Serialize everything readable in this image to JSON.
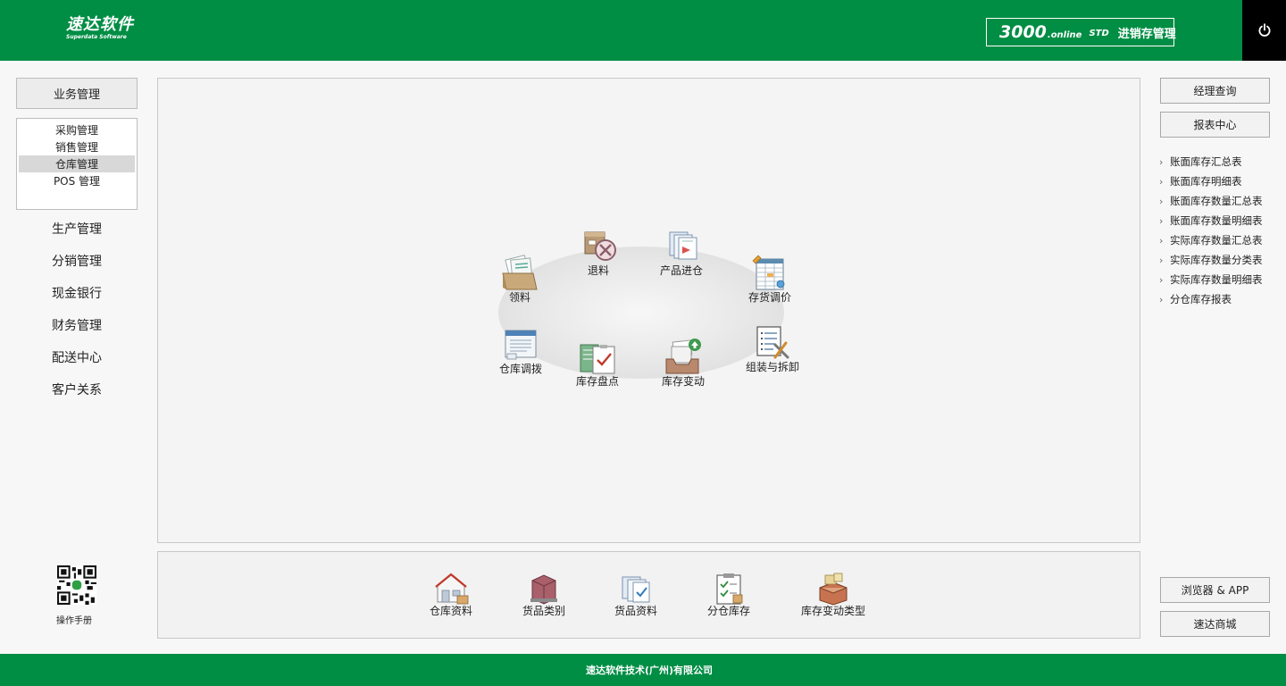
{
  "header": {
    "logo_cn": "速达软件",
    "logo_en": "Superdata Software",
    "product_num": "3000",
    "product_online": ".online",
    "product_std": "STD",
    "product_title": "进销存管理"
  },
  "left": {
    "section_head": "业务管理",
    "submenu": [
      {
        "label": "采购管理",
        "active": false
      },
      {
        "label": "销售管理",
        "active": false
      },
      {
        "label": "仓库管理",
        "active": true
      },
      {
        "label": "POS 管理",
        "active": false
      }
    ],
    "nav": [
      "生产管理",
      "分销管理",
      "现金银行",
      "财务管理",
      "配送中心",
      "客户关系"
    ],
    "qr_label": "操作手册"
  },
  "main": {
    "functions": {
      "lingliao": "领料",
      "tuiliao": "退料",
      "chanpin_jincang": "产品进仓",
      "cunhuo_tiaojia": "存货调价",
      "cangku_tiaobo": "仓库调拨",
      "kucun_pandian": "库存盘点",
      "kucun_biandong": "库存变动",
      "zuzhuang_chaixie": "组装与拆卸"
    },
    "bottom": [
      "仓库资料",
      "货品类别",
      "货品资料",
      "分仓库存",
      "库存变动类型"
    ]
  },
  "right": {
    "btn_manager_query": "经理查询",
    "btn_report_center": "报表中心",
    "reports": [
      "账面库存汇总表",
      "账面库存明细表",
      "账面库存数量汇总表",
      "账面库存数量明细表",
      "实际库存数量汇总表",
      "实际库存数量分类表",
      "实际库存数量明细表",
      "分仓库存报表"
    ],
    "btn_browser_app": "浏览器 & APP",
    "btn_mall": "速达商城"
  },
  "footer": {
    "company": "速达软件技术(广州)有限公司"
  },
  "colors": {
    "brand_green": "#008d44",
    "power_bg": "#000000"
  }
}
